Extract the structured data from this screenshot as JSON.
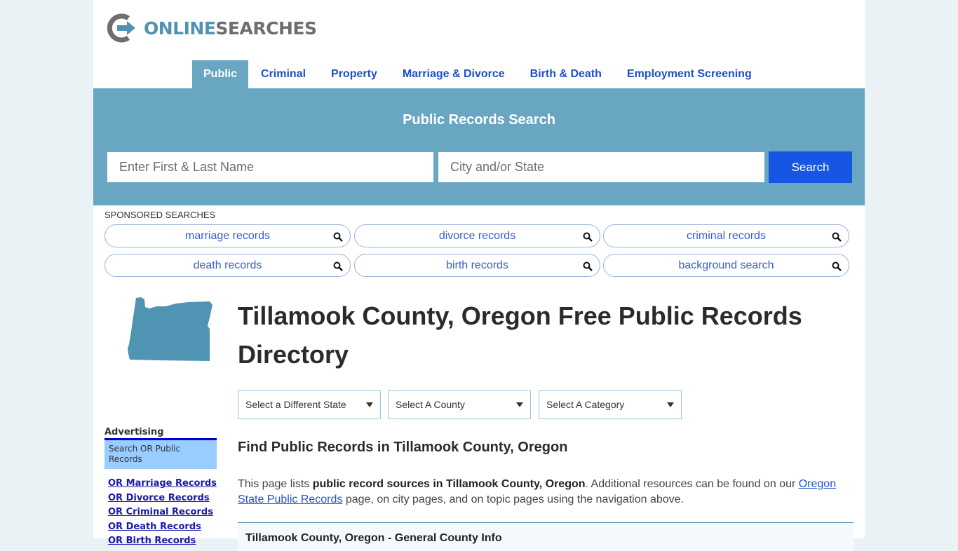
{
  "brand": {
    "logo_icon": "logo-arrow-icon",
    "name_part1": "ONLINE",
    "name_part2": "SEARCHES"
  },
  "nav": {
    "items": [
      {
        "label": "Public",
        "active": true
      },
      {
        "label": "Criminal",
        "active": false
      },
      {
        "label": "Property",
        "active": false
      },
      {
        "label": "Marriage & Divorce",
        "active": false
      },
      {
        "label": "Birth & Death",
        "active": false
      },
      {
        "label": "Employment Screening",
        "active": false
      }
    ]
  },
  "search": {
    "title": "Public Records Search",
    "name_placeholder": "Enter First & Last Name",
    "name_value": "",
    "location_placeholder": "City and/or State",
    "location_value": "",
    "button_label": "Search"
  },
  "sponsored": {
    "label": "SPONSORED SEARCHES",
    "items": [
      {
        "label": "marriage records",
        "icon": "search-icon"
      },
      {
        "label": "divorce records",
        "icon": "search-icon"
      },
      {
        "label": "criminal records",
        "icon": "search-icon"
      },
      {
        "label": "death records",
        "icon": "search-icon"
      },
      {
        "label": "birth records",
        "icon": "search-icon"
      },
      {
        "label": "background search",
        "icon": "search-icon"
      }
    ]
  },
  "sidebar": {
    "state_map_icon": "oregon-map-icon",
    "advertising_label": "Advertising",
    "ad_box_text": "Search OR Public Records",
    "links": [
      "OR Marriage Records",
      "OR Divorce Records",
      "OR Criminal Records",
      "OR Death Records",
      "OR Birth Records"
    ]
  },
  "main": {
    "title": "Tillamook County, Oregon Free Public Records Directory",
    "selects": [
      {
        "selected": "Select a Different State"
      },
      {
        "selected": "Select A County"
      },
      {
        "selected": "Select A Category"
      }
    ],
    "subtitle": "Find Public Records in Tillamook County, Oregon",
    "intro": {
      "prefix": "This page lists ",
      "bold": "public record sources in Tillamook County, Oregon",
      "middle": ". Additional resources can be found on our ",
      "link": "Oregon State Public Records",
      "suffix": " page, on city pages, and on topic pages using the navigation above."
    },
    "info_box_title": "Tillamook County, Oregon - General County Info"
  },
  "colors": {
    "page_bg": "#eaf2f6",
    "accent_teal": "#69a6c1",
    "search_button": "#1756e2",
    "nav_link": "#1f4fc4",
    "state_map": "#5094b3"
  }
}
